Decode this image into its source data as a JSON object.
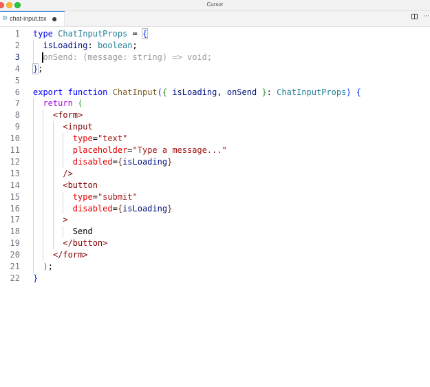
{
  "window": {
    "title": "Cursor"
  },
  "tab": {
    "filename": "chat-input.tsx",
    "icon": "react-gear-icon",
    "dirty_marker": "●"
  },
  "toolbar": {
    "more_label": "···"
  },
  "editor": {
    "active_line": 3,
    "lines": [
      {
        "n": "1",
        "tokens": [
          [
            "kw",
            "type"
          ],
          [
            "pl",
            " "
          ],
          [
            "type",
            "ChatInputProps"
          ],
          [
            "pl",
            " = "
          ],
          [
            "br1",
            "{"
          ]
        ]
      },
      {
        "n": "2",
        "tokens": [
          [
            "pl",
            "  "
          ],
          [
            "prop",
            "isLoading"
          ],
          [
            "pl",
            ": "
          ],
          [
            "type",
            "boolean"
          ],
          [
            "pl",
            ";"
          ]
        ]
      },
      {
        "n": "3",
        "tokens": [
          [
            "ghost",
            "  onSend: (message: string) => void;"
          ]
        ]
      },
      {
        "n": "4",
        "tokens": [
          [
            "br1",
            "}"
          ],
          [
            "pl",
            ";"
          ]
        ]
      },
      {
        "n": "5",
        "tokens": []
      },
      {
        "n": "6",
        "tokens": [
          [
            "kw",
            "export"
          ],
          [
            "pl",
            " "
          ],
          [
            "kw",
            "function"
          ],
          [
            "pl",
            " "
          ],
          [
            "fn",
            "ChatInput"
          ],
          [
            "br1",
            "("
          ],
          [
            "br2",
            "{"
          ],
          [
            "pl",
            " "
          ],
          [
            "prop",
            "isLoading"
          ],
          [
            "pl",
            ", "
          ],
          [
            "prop",
            "onSend"
          ],
          [
            "pl",
            " "
          ],
          [
            "br2",
            "}"
          ],
          [
            "pl",
            ": "
          ],
          [
            "type",
            "ChatInputProps"
          ],
          [
            "br1",
            ")"
          ],
          [
            "pl",
            " "
          ],
          [
            "br1",
            "{"
          ]
        ]
      },
      {
        "n": "7",
        "tokens": [
          [
            "pl",
            "  "
          ],
          [
            "ctl",
            "return"
          ],
          [
            "pl",
            " "
          ],
          [
            "br2",
            "("
          ]
        ]
      },
      {
        "n": "8",
        "tokens": [
          [
            "pl",
            "    "
          ],
          [
            "tag",
            "<form>"
          ]
        ]
      },
      {
        "n": "9",
        "tokens": [
          [
            "pl",
            "      "
          ],
          [
            "tag",
            "<input"
          ]
        ]
      },
      {
        "n": "10",
        "tokens": [
          [
            "pl",
            "        "
          ],
          [
            "attr",
            "type"
          ],
          [
            "pl",
            "="
          ],
          [
            "str",
            "\"text\""
          ]
        ]
      },
      {
        "n": "11",
        "tokens": [
          [
            "pl",
            "        "
          ],
          [
            "attr",
            "placeholder"
          ],
          [
            "pl",
            "="
          ],
          [
            "str",
            "\"Type a message...\""
          ]
        ]
      },
      {
        "n": "12",
        "tokens": [
          [
            "pl",
            "        "
          ],
          [
            "attr",
            "disabled"
          ],
          [
            "pl",
            "="
          ],
          [
            "br3",
            "{"
          ],
          [
            "prop",
            "isLoading"
          ],
          [
            "br3",
            "}"
          ]
        ]
      },
      {
        "n": "13",
        "tokens": [
          [
            "pl",
            "      "
          ],
          [
            "tag",
            "/>"
          ]
        ]
      },
      {
        "n": "14",
        "tokens": [
          [
            "pl",
            "      "
          ],
          [
            "tag",
            "<button"
          ]
        ]
      },
      {
        "n": "15",
        "tokens": [
          [
            "pl",
            "        "
          ],
          [
            "attr",
            "type"
          ],
          [
            "pl",
            "="
          ],
          [
            "str",
            "\"submit\""
          ]
        ]
      },
      {
        "n": "16",
        "tokens": [
          [
            "pl",
            "        "
          ],
          [
            "attr",
            "disabled"
          ],
          [
            "pl",
            "="
          ],
          [
            "br3",
            "{"
          ],
          [
            "prop",
            "isLoading"
          ],
          [
            "br3",
            "}"
          ]
        ]
      },
      {
        "n": "17",
        "tokens": [
          [
            "pl",
            "      "
          ],
          [
            "tag",
            ">"
          ]
        ]
      },
      {
        "n": "18",
        "tokens": [
          [
            "pl",
            "        Send"
          ]
        ]
      },
      {
        "n": "19",
        "tokens": [
          [
            "pl",
            "      "
          ],
          [
            "tag",
            "</button>"
          ]
        ]
      },
      {
        "n": "20",
        "tokens": [
          [
            "pl",
            "    "
          ],
          [
            "tag",
            "</form>"
          ]
        ]
      },
      {
        "n": "21",
        "tokens": [
          [
            "pl",
            "  "
          ],
          [
            "br2",
            ")"
          ],
          [
            "pl",
            ";"
          ]
        ]
      },
      {
        "n": "22",
        "tokens": [
          [
            "br1",
            "}"
          ]
        ]
      }
    ]
  },
  "colors": {
    "accent": "#2c7ad6",
    "keyword": "#0000ff",
    "type": "#267f99",
    "string": "#a31515",
    "tag": "#800000",
    "attribute": "#e50000"
  }
}
